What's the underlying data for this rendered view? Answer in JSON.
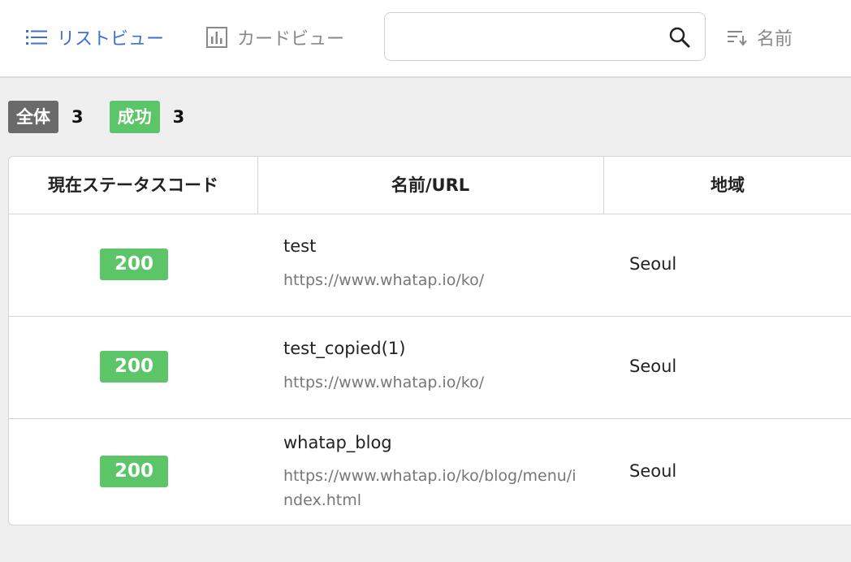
{
  "toolbar": {
    "list_view_label": "リストビュー",
    "card_view_label": "カードビュー",
    "search_placeholder": "",
    "sort_label": "名前"
  },
  "summary": {
    "total_label": "全体",
    "total_count": "3",
    "success_label": "成功",
    "success_count": "3"
  },
  "table": {
    "headers": [
      "現在ステータスコード",
      "名前/URL",
      "地域"
    ],
    "rows": [
      {
        "status": "200",
        "name": "test",
        "url": "https://www.whatap.io/ko/",
        "region": "Seoul"
      },
      {
        "status": "200",
        "name": "test_copied(1)",
        "url": "https://www.whatap.io/ko/",
        "region": "Seoul"
      },
      {
        "status": "200",
        "name": "whatap_blog",
        "url": "https://www.whatap.io/ko/blog/menu/index.html",
        "region": "Seoul"
      }
    ]
  },
  "colors": {
    "accent": "#3d6fd8",
    "success": "#5bc568",
    "total_badge": "#6a6a6a"
  },
  "icons": [
    "list-icon",
    "bar-chart-icon",
    "search-icon",
    "sort-icon"
  ]
}
